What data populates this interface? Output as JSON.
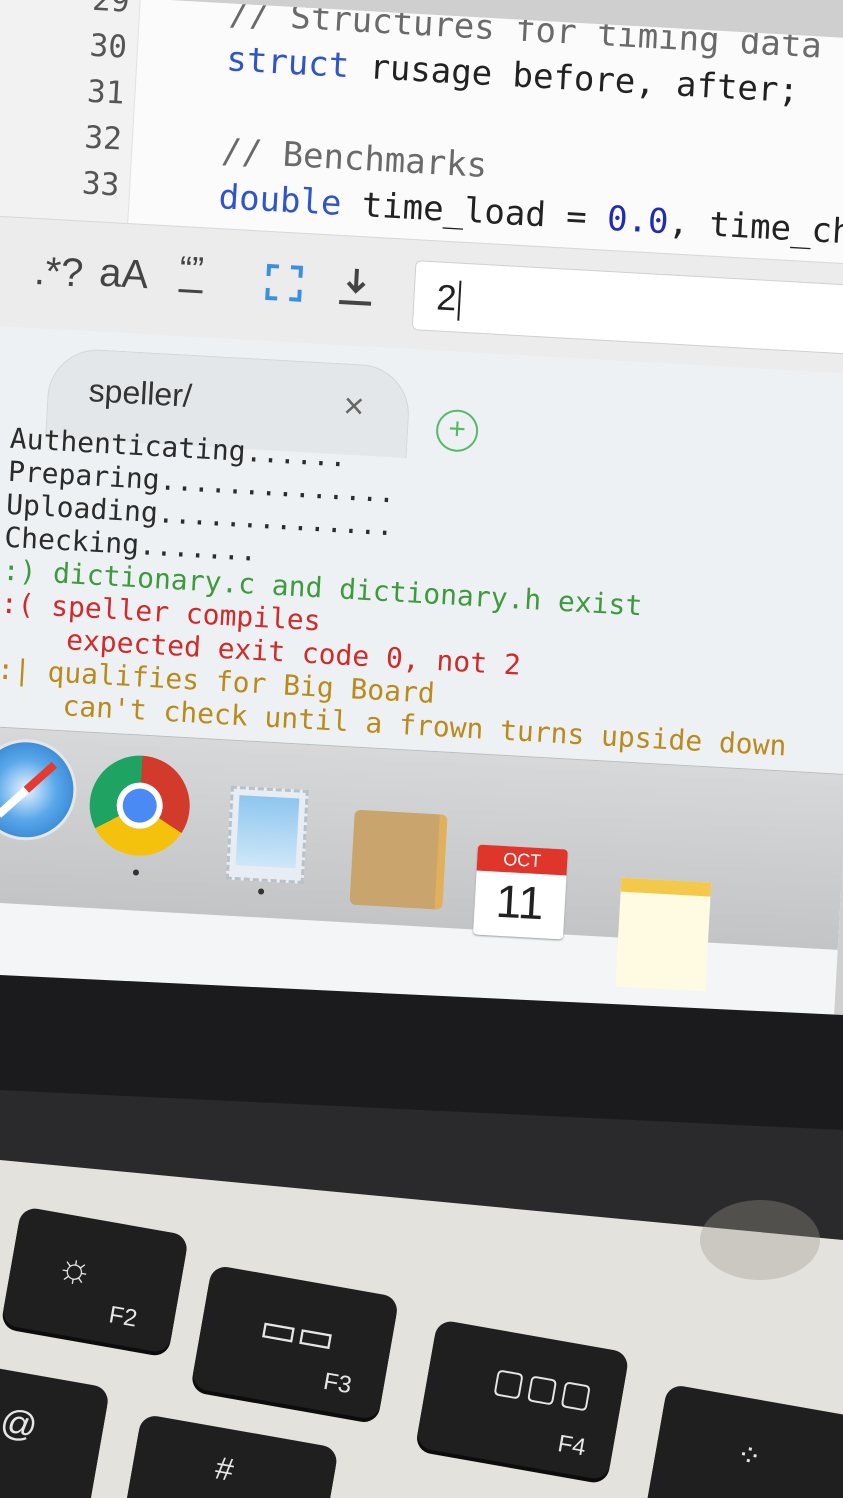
{
  "editor": {
    "line_numbers": [
      "29",
      "30",
      "31",
      "32",
      "33"
    ],
    "lines": [
      {
        "comment": "// Structures for timing data"
      },
      {
        "keyword": "struct",
        "text": " rusage before, after;"
      },
      {
        "text": ""
      },
      {
        "comment": "// Benchmarks"
      },
      {
        "keyword": "double",
        "text_a": " time_load = ",
        "num": "0.0",
        "text_b": ", time_che"
      }
    ]
  },
  "findbar": {
    "regex_label": ".*?",
    "case_label": "aA",
    "whole_word_label": "“”",
    "search_value": "2"
  },
  "terminal": {
    "tab_title": "speller/",
    "tab_close": "×",
    "tab_add": "+",
    "lines": [
      "Authenticating......",
      "Preparing..............",
      "Uploading..............",
      "Checking.......",
      ":) dictionary.c and dictionary.h exist",
      ":( speller compiles",
      "    expected exit code 0, not 2",
      ":| qualifies for Big Board",
      "    can't check until a frown turns upside down"
    ]
  },
  "dock": {
    "apps": [
      "safari-icon",
      "chrome-icon",
      "mail-icon",
      "contacts-icon",
      "calendar-icon",
      "notes-icon"
    ],
    "calendar_month": "OCT",
    "calendar_day": "11"
  },
  "keyboard": {
    "f2": "F2",
    "f3": "F3",
    "f4": "F4",
    "hash": "#"
  }
}
